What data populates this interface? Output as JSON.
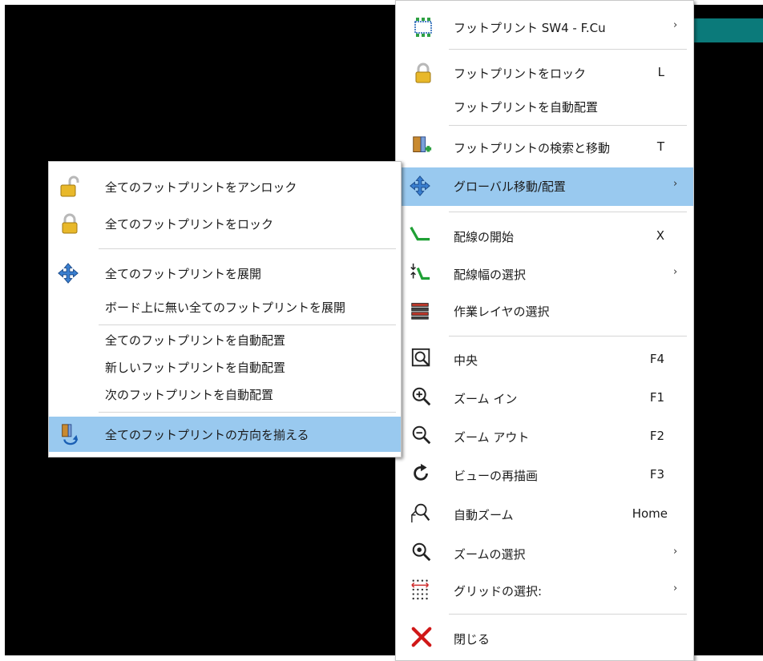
{
  "main_menu": {
    "items": [
      {
        "label": "フットプリント SW4 - F.Cu",
        "shortcut": "",
        "submenu": true,
        "icon": "footprint-icon"
      },
      {
        "label": "フットプリントをロック",
        "shortcut": "L",
        "submenu": false,
        "icon": "lock-icon"
      },
      {
        "label": "フットプリントを自動配置",
        "shortcut": "",
        "submenu": false,
        "icon": ""
      },
      {
        "label": "フットプリントの検索と移動",
        "shortcut": "T",
        "submenu": false,
        "icon": "find-move-icon"
      },
      {
        "label": "グローバル移動/配置",
        "shortcut": "",
        "submenu": true,
        "icon": "move-arrows-icon",
        "highlighted": true
      },
      {
        "label": "配線の開始",
        "shortcut": "X",
        "submenu": false,
        "icon": "route-track-icon"
      },
      {
        "label": "配線幅の選択",
        "shortcut": "",
        "submenu": true,
        "icon": "track-width-icon"
      },
      {
        "label": "作業レイヤの選択",
        "shortcut": "",
        "submenu": false,
        "icon": "layers-icon"
      },
      {
        "label": "中央",
        "shortcut": "F4",
        "submenu": false,
        "icon": "zoom-center-icon"
      },
      {
        "label": "ズーム イン",
        "shortcut": "F1",
        "submenu": false,
        "icon": "zoom-in-icon"
      },
      {
        "label": "ズーム アウト",
        "shortcut": "F2",
        "submenu": false,
        "icon": "zoom-out-icon"
      },
      {
        "label": "ビューの再描画",
        "shortcut": "F3",
        "submenu": false,
        "icon": "redraw-icon"
      },
      {
        "label": "自動ズーム",
        "shortcut": "Home",
        "submenu": false,
        "icon": "zoom-fit-icon"
      },
      {
        "label": "ズームの選択",
        "shortcut": "",
        "submenu": true,
        "icon": "zoom-select-icon"
      },
      {
        "label": "グリッドの選択:",
        "shortcut": "",
        "submenu": true,
        "icon": "grid-icon"
      },
      {
        "label": "閉じる",
        "shortcut": "",
        "submenu": false,
        "icon": "close-icon"
      }
    ],
    "arrow_glyph": "›"
  },
  "sub_menu": {
    "items": [
      {
        "label": "全てのフットプリントをアンロック",
        "icon": "unlock-icon"
      },
      {
        "label": "全てのフットプリントをロック",
        "icon": "lock-icon"
      },
      {
        "label": "全てのフットプリントを展開",
        "icon": "move-arrows-icon"
      },
      {
        "label": "ボード上に無い全てのフットプリントを展開",
        "icon": ""
      },
      {
        "label": "全てのフットプリントを自動配置",
        "icon": ""
      },
      {
        "label": "新しいフットプリントを自動配置",
        "icon": ""
      },
      {
        "label": "次のフットプリントを自動配置",
        "icon": ""
      },
      {
        "label": "全てのフットプリントの方向を揃える",
        "icon": "orient-icon",
        "highlighted": true
      }
    ]
  },
  "colors": {
    "canvas": "#000000",
    "highlight": "#99c9ef",
    "teal_strip": "#0b7a7a"
  }
}
